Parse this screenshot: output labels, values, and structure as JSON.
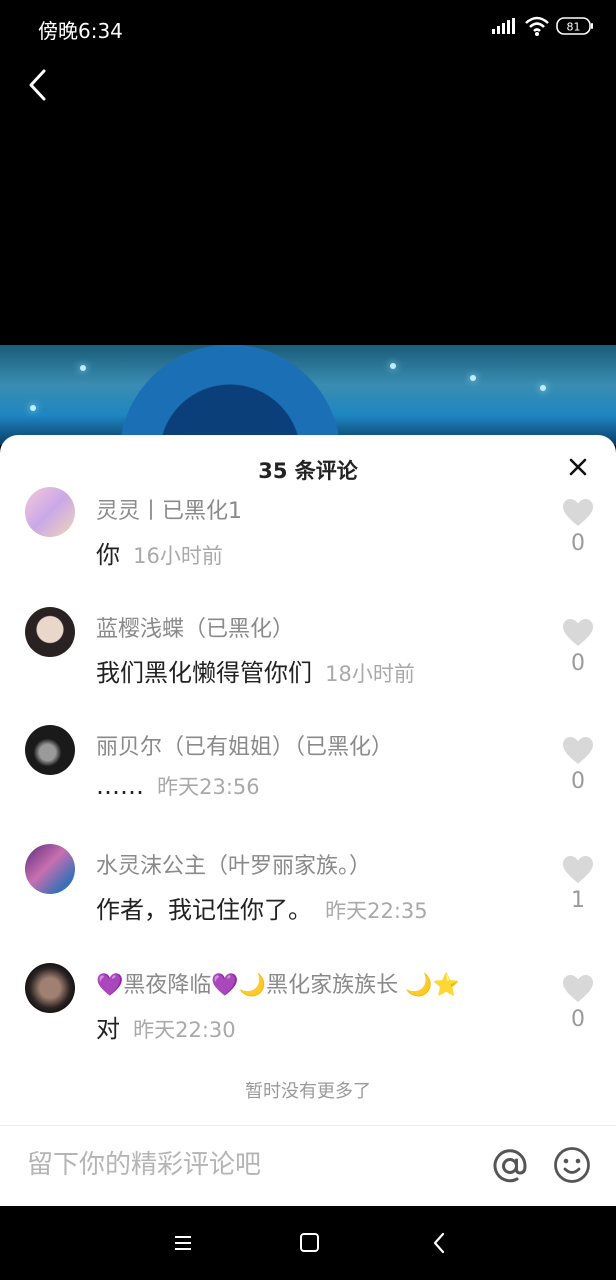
{
  "status_bar": {
    "time": "傍晚6:34",
    "battery": "81"
  },
  "comments_sheet": {
    "title": "35 条评论",
    "comments": [
      {
        "name": "灵灵丨已黑化1",
        "text": "你",
        "time": "16小时前",
        "likes": "0"
      },
      {
        "name": "蓝樱浅蝶（已黑化）",
        "text": "我们黑化懒得管你们",
        "time": "18小时前",
        "likes": "0"
      },
      {
        "name": "丽贝尔（已有姐姐）（已黑化）",
        "text": "……",
        "time": "昨天23:56",
        "likes": "0"
      },
      {
        "name": "水灵沫公主（叶罗丽家族。）",
        "text": "作者，我记住你了。",
        "time": "昨天22:35",
        "likes": "1"
      },
      {
        "name": "💜黑夜降临💜🌙黑化家族族长 🌙⭐",
        "text": "对",
        "time": "昨天22:30",
        "likes": "0"
      }
    ],
    "no_more_text": "暂时没有更多了"
  },
  "input_bar": {
    "placeholder": "留下你的精彩评论吧"
  },
  "icons": {
    "back": "chevron-left-icon",
    "close": "close-icon",
    "like": "heart-icon",
    "mention": "at-icon",
    "emoji": "smiley-icon"
  },
  "colors": {
    "like_heart": "#d8d8d8",
    "username": "#8a8a8a",
    "time": "#a9a9a9"
  }
}
